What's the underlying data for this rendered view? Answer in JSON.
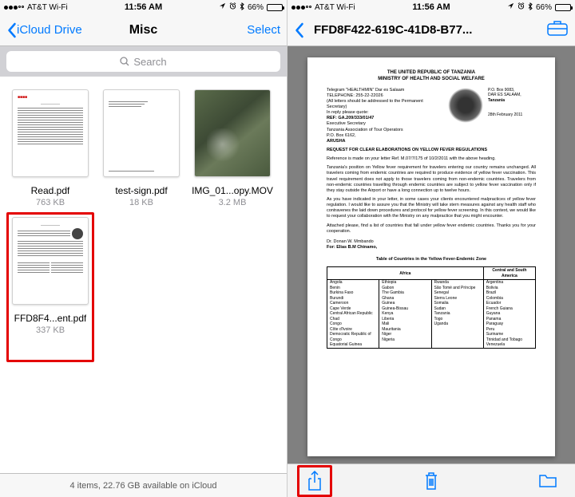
{
  "status": {
    "carrier": "AT&T Wi-Fi",
    "time": "11:56 AM",
    "battery_pct": "66%"
  },
  "left": {
    "back_label": "iCloud Drive",
    "title": "Misc",
    "action": "Select",
    "search_placeholder": "Search",
    "files": [
      {
        "name": "Read.pdf",
        "size": "763 KB"
      },
      {
        "name": "test-sign.pdf",
        "size": "18 KB"
      },
      {
        "name": "IMG_01...opy.MOV",
        "size": "3.2 MB"
      },
      {
        "name": "FFD8F4...ent.pdf",
        "size": "337 KB"
      }
    ],
    "footer": "4 items, 22.76 GB available on iCloud"
  },
  "right": {
    "title": "FFD8F422-619C-41D8-B77...",
    "doc": {
      "header1": "THE UNITED REPUBLIC OF TANZANIA",
      "header2": "MINISTRY OF HEALTH AND SOCIAL WELFARE",
      "telegram": "Telegram \"HEALTHMIN\" Dar es Salaam",
      "telephone": "TELEPHONE: 255-22-22026",
      "addr": "(All letters should be addressed to the Permanent Secretary)",
      "reply": "In reply please quote:",
      "ref": "REF: GA.209/333/01/47",
      "exec": "Executive Secretary",
      "assoc": "Tanzania Association of Tour Operators",
      "pobox": "P.O. Box 6162,",
      "city": "ARUSHA",
      "right_addr1": "P.O. Box 9083,",
      "right_addr2": "DAR ES SALAAM,",
      "right_addr3": "Tanzania",
      "date": "28th February 2011",
      "subject": "REQUEST FOR CLEAR ELABORATIONS ON YELLOW FEVER REGULATIONS",
      "para1": "Reference is made on your letter Ref. M.07/7/175 of 10/2/2011 with the above heading.",
      "para2": "Tanzania's position on Yellow fever requirement for travelers entering our country remains unchanged. All travelers coming from endemic countries are required to produce evidence of yellow fever vaccination. This travel requirement does not apply to those travelers coming from non-endemic countries. Travelers from non-endemic countries travelling through endemic countries are subject to yellow fever vaccination only if they stay outside the Airport or have a long connection up to twelve hours.",
      "para3": "As you have indicated in your letter, in some cases your clients encountered malpractices of yellow fever regulation. I would like to assure you that the Ministry will take stern measures against any health staff who contravenes the laid down procedures and protocol for yellow fever screening. In this context, we would like to request your collaboration with the Ministry on any malpractice that you might encounter.",
      "para4": "Attached please, find a list of countries that fall under yellow fever endemic countries. Thanks you for your cooperation.",
      "sign1": "Dr. Donan W. Mmbando",
      "sign2": "For: Elias B.M Chinamo,",
      "table_title": "Table of Countries in the Yellow Fever-Endemic Zone",
      "th_africa": "Africa",
      "th_america": "Central and South America",
      "africa_c1": [
        "Angola",
        "Benin",
        "Burkina Faso",
        "Burundi",
        "Cameroon",
        "Cape Verde",
        "Central African Republic",
        "Chad",
        "Congo",
        "Côte d'Ivoire",
        "Democratic Republic of Congo",
        "Equatorial Guinea"
      ],
      "africa_c2": [
        "Ethiopia",
        "Gabon",
        "The Gambia",
        "Ghana",
        "Guinea",
        "Guinea-Bissau",
        "Kenya",
        "Liberia",
        "Mali",
        "Mauritania",
        "Niger",
        "Nigeria"
      ],
      "africa_c3": [
        "Rwanda",
        "São Tomé and Príncipe",
        "Senegal",
        "Sierra Leone",
        "Somalia",
        "Sudan",
        "Tanzania",
        "Togo",
        "Uganda"
      ],
      "america": [
        "Argentina",
        "Bolivia",
        "Brazil",
        "Colombia",
        "Ecuador",
        "French Guiana",
        "Guyana",
        "Panama",
        "Paraguay",
        "Peru",
        "Suriname",
        "Trinidad and Tobago",
        "Venezuela"
      ]
    }
  }
}
